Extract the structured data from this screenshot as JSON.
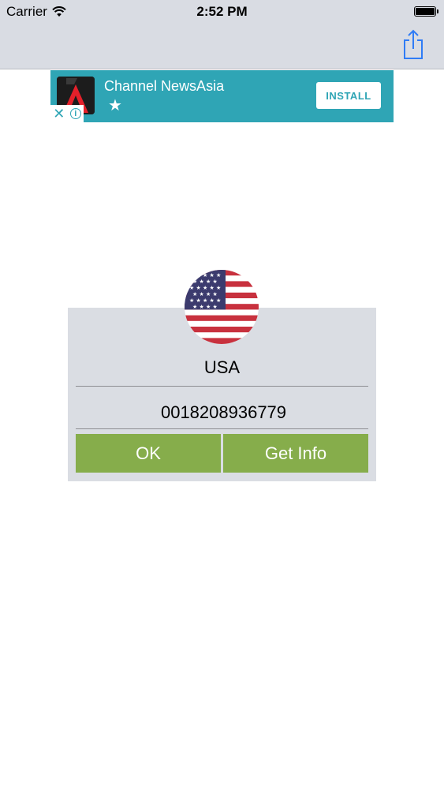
{
  "status_bar": {
    "carrier": "Carrier",
    "time": "2:52 PM"
  },
  "navbar": {
    "share_icon": "share-icon"
  },
  "ad": {
    "title": "Channel NewsAsia",
    "star": "★",
    "install_label": "INSTALL",
    "close_symbol": "✕",
    "info_symbol": "i"
  },
  "card": {
    "country": "USA",
    "phone_number": "0018208936779",
    "ok_label": "OK",
    "get_info_label": "Get Info"
  },
  "colors": {
    "navbar_bg": "#d9dce3",
    "ad_bg": "#2fa5b5",
    "card_bg": "#dadde3",
    "button_green": "#86ad4b"
  }
}
